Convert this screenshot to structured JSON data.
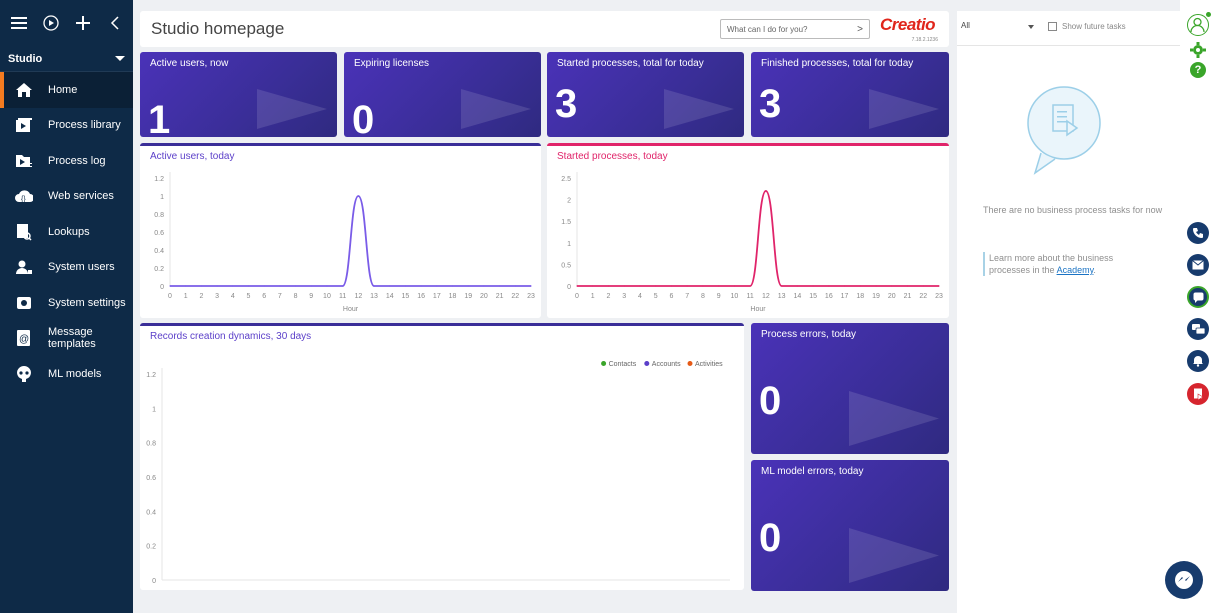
{
  "sidebar": {
    "section": "Studio",
    "items": [
      {
        "label": "Home",
        "icon": "home-icon"
      },
      {
        "label": "Process library",
        "icon": "process-library-icon"
      },
      {
        "label": "Process log",
        "icon": "process-log-icon"
      },
      {
        "label": "Web services",
        "icon": "web-services-icon"
      },
      {
        "label": "Lookups",
        "icon": "lookups-icon"
      },
      {
        "label": "System users",
        "icon": "system-users-icon"
      },
      {
        "label": "System settings",
        "icon": "system-settings-icon"
      },
      {
        "label": "Message templates",
        "icon": "message-templates-icon"
      },
      {
        "label": "ML models",
        "icon": "ml-models-icon"
      }
    ]
  },
  "header": {
    "title": "Studio homepage",
    "command_placeholder": "What can I do for you?",
    "logo_text": "Creatio",
    "version": "7.18.2.1236"
  },
  "tiles": {
    "active_users_now": {
      "label": "Active users, now",
      "value": "1"
    },
    "expiring_licenses": {
      "label": "Expiring licenses",
      "value": "0"
    },
    "started_processes": {
      "label": "Started processes, total for today",
      "value": "3"
    },
    "finished_processes": {
      "label": "Finished processes, total for today",
      "value": "3"
    },
    "process_errors": {
      "label": "Process errors, today",
      "value": "0"
    },
    "ml_model_errors": {
      "label": "ML model errors, today",
      "value": "0"
    }
  },
  "right_panel": {
    "filter": "All",
    "show_future": "Show future tasks",
    "empty_text": "There are no business process tasks for now",
    "learn_text": "Learn more about the business processes in the",
    "learn_link": "Academy",
    "learn_end": "."
  },
  "colors": {
    "sidebar": "#0e2a47",
    "tile": "#3f30a8",
    "active_users_line": "#7a5ce8",
    "started_line": "#e0246a",
    "brand": "#e0251b"
  },
  "chart_data": [
    {
      "type": "line",
      "title": "Active users, today",
      "xlabel": "Hour",
      "x": [
        0,
        1,
        2,
        3,
        4,
        5,
        6,
        7,
        8,
        9,
        10,
        11,
        12,
        13,
        14,
        15,
        16,
        17,
        18,
        19,
        20,
        21,
        22,
        23
      ],
      "values": [
        0,
        0,
        0,
        0,
        0,
        0,
        0,
        0,
        0,
        0,
        0,
        0,
        1,
        0,
        0,
        0,
        0,
        0,
        0,
        0,
        0,
        0,
        0,
        0
      ],
      "ylim": [
        0,
        1.2
      ],
      "yticks": [
        "0",
        "0.2",
        "0.4",
        "0.6",
        "0.8",
        "1",
        "1.2"
      ]
    },
    {
      "type": "line",
      "title": "Started processes, today",
      "xlabel": "Hour",
      "x": [
        0,
        1,
        2,
        3,
        4,
        5,
        6,
        7,
        8,
        9,
        10,
        11,
        12,
        13,
        14,
        15,
        16,
        17,
        18,
        19,
        20,
        21,
        22,
        23
      ],
      "values": [
        0,
        0,
        0,
        0,
        0,
        0,
        0,
        0,
        0,
        0,
        0,
        0,
        2.2,
        0,
        0,
        0,
        0,
        0,
        0,
        0,
        0,
        0,
        0,
        0
      ],
      "ylim": [
        0,
        2.5
      ],
      "yticks": [
        "0",
        "0.5",
        "1",
        "1.5",
        "2",
        "2.5"
      ]
    },
    {
      "type": "line",
      "title": "Records creation dynamics, 30 days",
      "legend": [
        "Contacts",
        "Accounts",
        "Activities"
      ],
      "legend_colors": [
        "#3aa52a",
        "#5b3fc9",
        "#e65a16"
      ],
      "legend_position": "top-right",
      "ylim": [
        0,
        1.2
      ],
      "yticks": [
        "0",
        "0.2",
        "0.4",
        "0.6",
        "0.8",
        "1",
        "1.2"
      ]
    }
  ]
}
